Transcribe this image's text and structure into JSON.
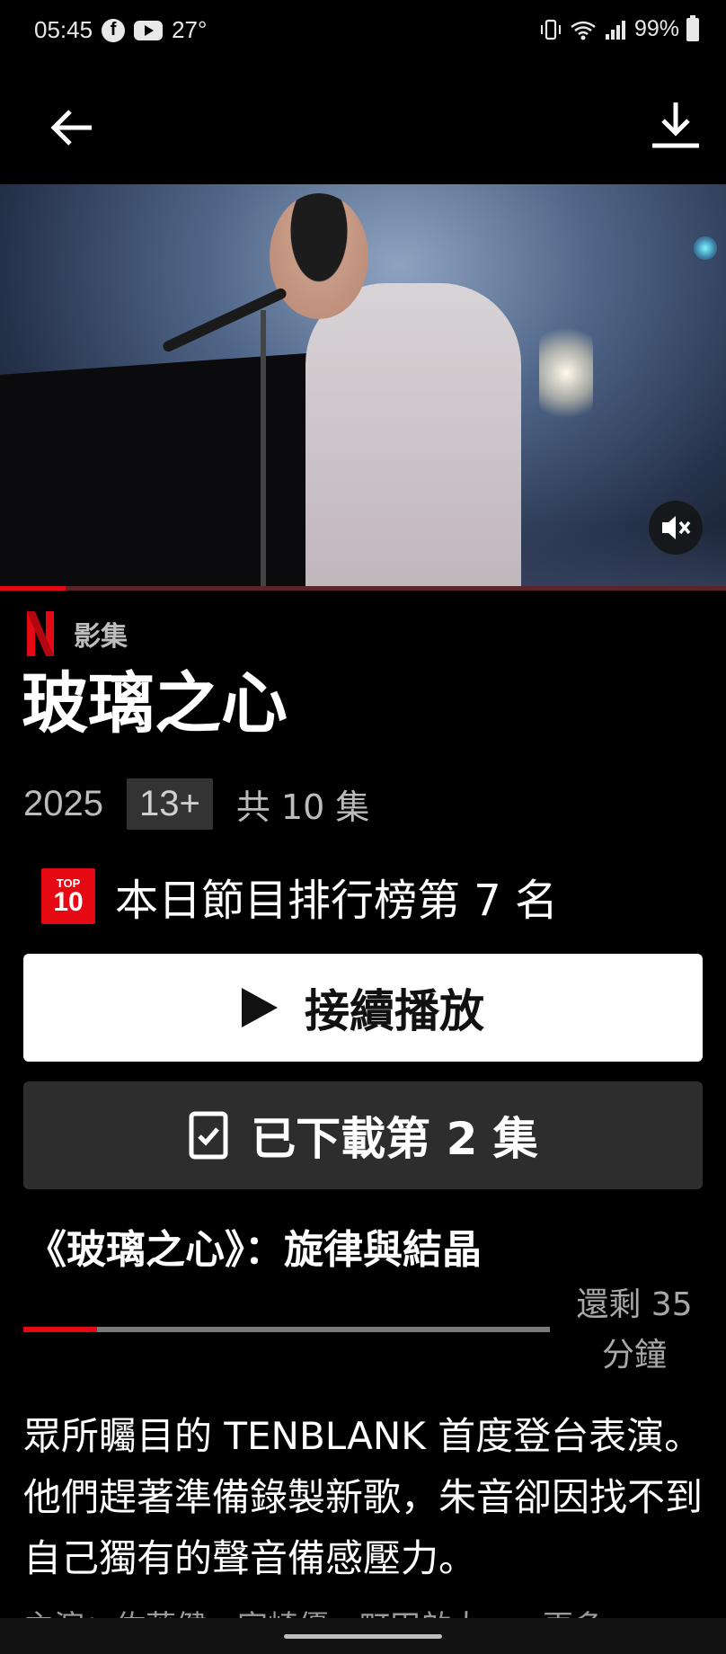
{
  "status_bar": {
    "time": "05:45",
    "temperature": "27°",
    "battery": "99%",
    "icons": [
      "facebook-icon",
      "youtube-icon",
      "vibrate-icon",
      "wifi-icon",
      "signal-icon",
      "battery-icon"
    ]
  },
  "hero": {
    "playback_progress": 0.09,
    "mute_icon": "mute-icon"
  },
  "show": {
    "type_label": "影集",
    "title": "玻璃之心",
    "year": "2025",
    "rating": "13+",
    "episodes": "共 10 集",
    "top10_badge_top": "TOP",
    "top10_badge_num": "10",
    "rank_text": "本日節目排行榜第 7 名"
  },
  "actions": {
    "play_label": "接續播放",
    "downloaded_label": "已下載第 2 集"
  },
  "episode": {
    "title": "《玻璃之心》：旋律與結晶",
    "remaining": "還剩 35 分鐘",
    "progress": 0.14
  },
  "synopsis": "眾所矚目的 TENBLANK 首度登台表演。他們趕著準備錄製新歌，朱音卻因找不到自己獨有的聲音備感壓力。",
  "cast": "主演：佐藤健、宮崎優、町田啟太……更多",
  "colors": {
    "accent": "#e50914",
    "background": "#000000",
    "secondary_button": "#2d2d2d"
  }
}
